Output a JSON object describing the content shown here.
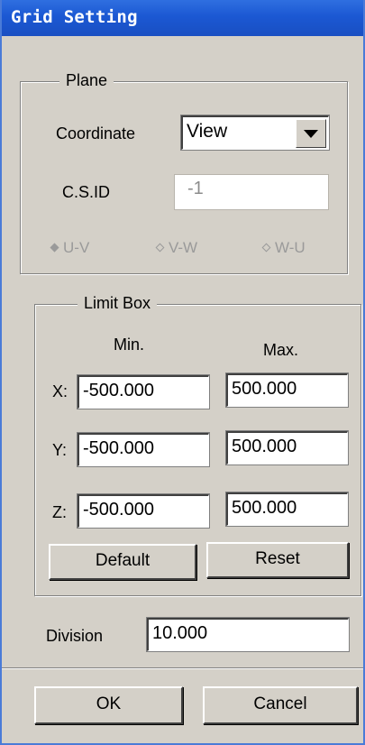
{
  "window": {
    "title": "Grid Setting"
  },
  "plane": {
    "legend": "Plane",
    "coordinate_label": "Coordinate",
    "coordinate_value": "View",
    "csid_label": "C.S.ID",
    "csid_value": "-1",
    "radios": [
      {
        "label": "U-V",
        "selected": true
      },
      {
        "label": "V-W",
        "selected": false
      },
      {
        "label": "W-U",
        "selected": false
      }
    ]
  },
  "limit_box": {
    "legend": "Limit Box",
    "min_header": "Min.",
    "max_header": "Max.",
    "rows": [
      {
        "axis": "X:",
        "min": "-500.000",
        "max": "500.000"
      },
      {
        "axis": "Y:",
        "min": "-500.000",
        "max": "500.000"
      },
      {
        "axis": "Z:",
        "min": "-500.000",
        "max": "500.000"
      }
    ],
    "default_label": "Default",
    "reset_label": "Reset"
  },
  "division": {
    "label": "Division",
    "value": "10.000"
  },
  "footer": {
    "ok_label": "OK",
    "cancel_label": "Cancel"
  },
  "colors": {
    "titlebar": "#1b58d3",
    "face": "#d4d0c8"
  }
}
